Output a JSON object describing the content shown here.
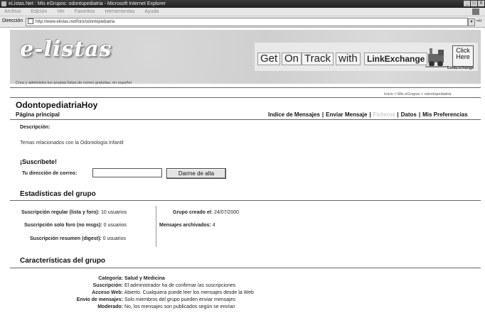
{
  "window": {
    "title": "eListas.Net : Mis eGrupos: odontopediatria - Microsoft Internet Explorer",
    "controls": [
      "_",
      "□",
      "X"
    ]
  },
  "menu": {
    "items": [
      "Archivo",
      "Edición",
      "Ver",
      "Favoritos",
      "Herramientas",
      "Ayuda"
    ]
  },
  "address": {
    "label": "Dirección",
    "url": "http://www.elistas.net/foro/odontopediatria",
    "go_label": "Ir"
  },
  "banner": {
    "logo_text": "e-listas",
    "tagline": "Crea y administra tus propias listas de correo gratuitas, en español",
    "ad_words": [
      "Get",
      "On",
      "Track",
      "with"
    ],
    "ad_brand": "LinkExchange",
    "ad_click": "Click Here",
    "ad_footer": "LinkExchange"
  },
  "breadcrumb": "Inicio > Mis eGrupos > odontopediatria",
  "group": {
    "title": "OdontopediatriaHoy",
    "page_label": "Página principal"
  },
  "nav": {
    "items": [
      "Indice de Mensajes",
      "Enviar Mensaje",
      "Ficheros",
      "Datos",
      "Mis Preferencias"
    ],
    "disabled": [
      "Ficheros"
    ]
  },
  "description": {
    "label": "Descripción:",
    "text": "Temas relacionados con la Odontología Infantil"
  },
  "subscribe": {
    "title": "¡Suscríbete!",
    "email_label": "Tu dirección de correo:",
    "email_value": "",
    "button_label": "Darme de alta"
  },
  "stats": {
    "title": "Estadísticas del grupo",
    "reg_label": "Suscripción regular (lista y foro):",
    "reg_value": "10 usuarios",
    "foro_label": "Suscripción solo foro (no msgs):",
    "foro_value": "0 usuarios",
    "digest_label": "Suscripción resumen (digest):",
    "digest_value": "0 usuarios",
    "created_label": "Grupo creado el:",
    "created_value": "24/07/2000",
    "archived_label": "Mensajes archivados:",
    "archived_value": "4"
  },
  "features": {
    "title": "Características del grupo",
    "rows": [
      {
        "key": "Categoría:",
        "value": "Salud y Medicina",
        "bold_value": true
      },
      {
        "key": "Suscripción:",
        "value": "El administrador ha de confirmar las suscripciones",
        "bold_value": false
      },
      {
        "key": "Acceso Web:",
        "value": "Abierto. Cualquiera puede leer los mensajes desde la Web",
        "bold_value": false
      },
      {
        "key": "Envío de mensajes:",
        "value": "Solo miembros del grupo pueden enviar mensajes",
        "bold_value": false
      },
      {
        "key": "Moderado:",
        "value": "No, los mensajes son publicados según se envían",
        "bold_value": false
      }
    ]
  }
}
